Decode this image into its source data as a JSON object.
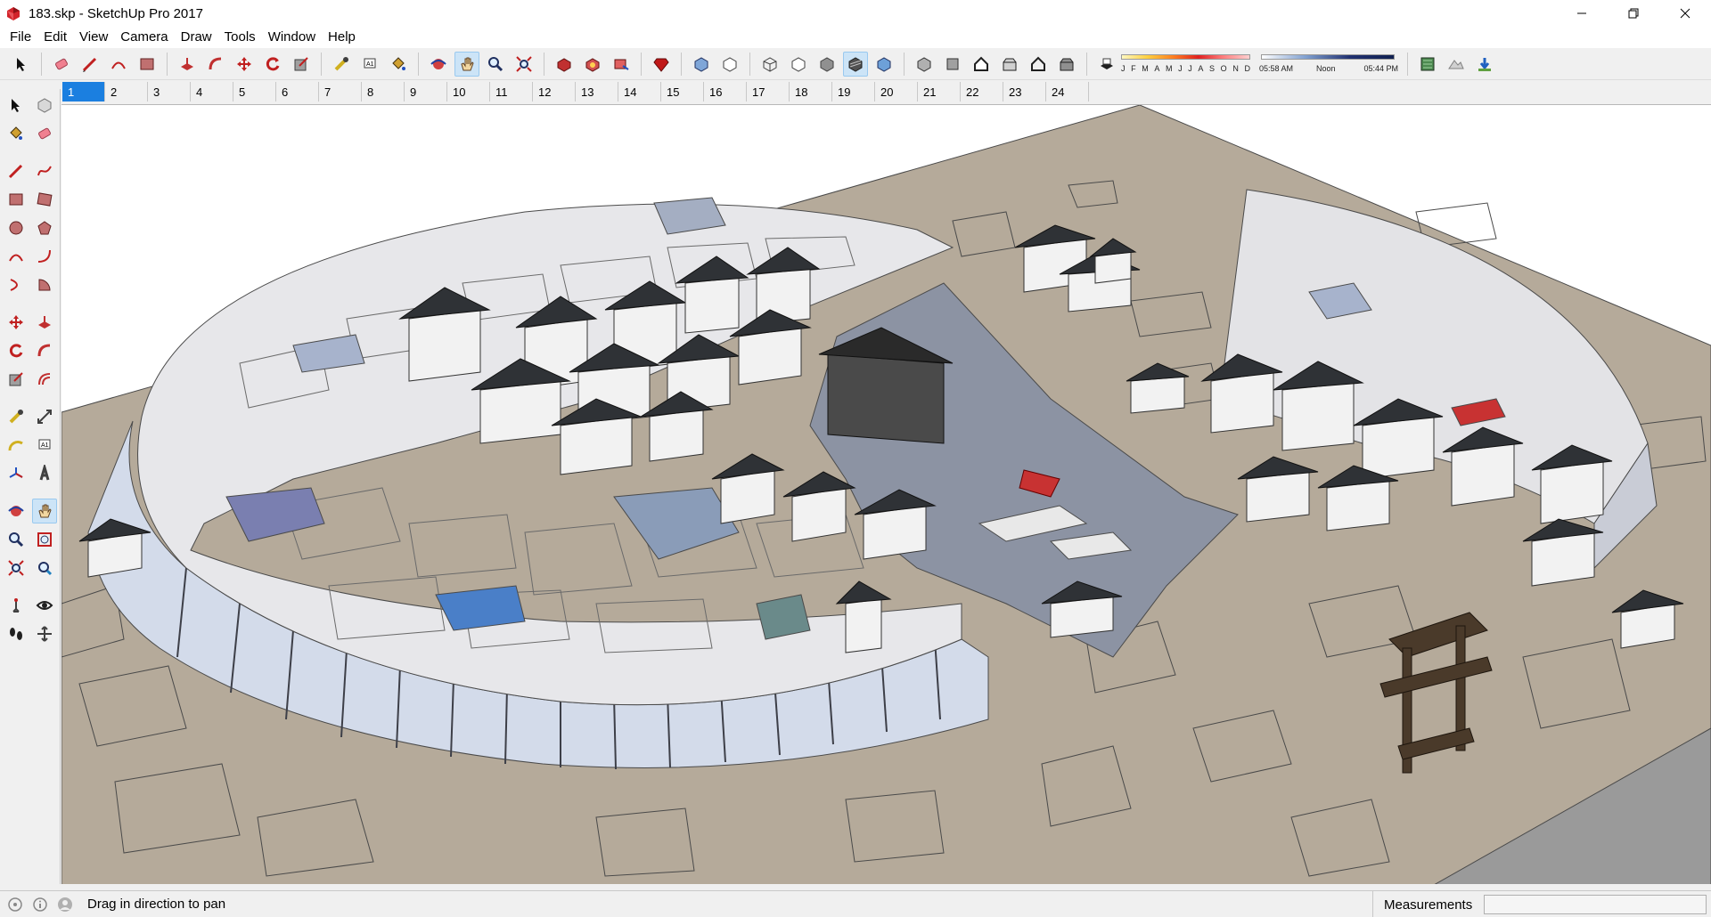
{
  "window": {
    "title": "183.skp - SketchUp Pro 2017",
    "app_icon": "sketchup-icon"
  },
  "menu": [
    "File",
    "Edit",
    "View",
    "Camera",
    "Draw",
    "Tools",
    "Window",
    "Help"
  ],
  "shadows": {
    "months": [
      "J",
      "F",
      "M",
      "A",
      "M",
      "J",
      "J",
      "A",
      "S",
      "O",
      "N",
      "D"
    ],
    "time_start": "05:58 AM",
    "time_mid": "Noon",
    "time_end": "05:44 PM"
  },
  "scenes": [
    "1",
    "2",
    "3",
    "4",
    "5",
    "6",
    "7",
    "8",
    "9",
    "10",
    "11",
    "12",
    "13",
    "14",
    "15",
    "16",
    "17",
    "18",
    "19",
    "20",
    "21",
    "22",
    "23",
    "24"
  ],
  "active_scene": "1",
  "status": {
    "hint": "Drag in direction to pan",
    "measurements_label": "Measurements",
    "measurements_value": ""
  },
  "colors": {
    "ground": "#b5aa9a",
    "roof": "#e7e7ea",
    "water": "#8c93a3",
    "glass": "#d3dbea",
    "tile": "#2f3236",
    "accent": "#1b7fe0"
  }
}
